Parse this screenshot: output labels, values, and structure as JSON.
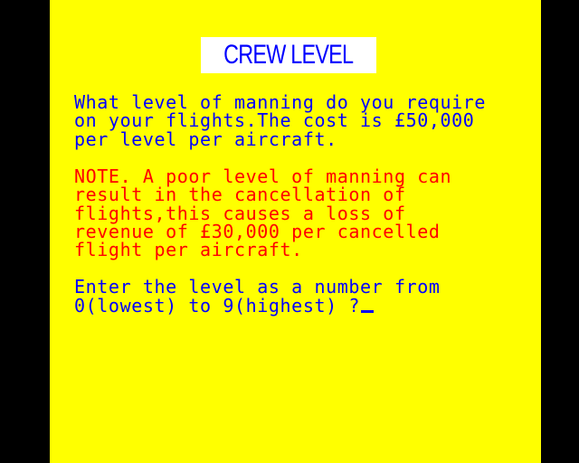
{
  "colors": {
    "background": "#ffff00",
    "border": "#000000",
    "title_box": "#ffffff",
    "title_text": "#0000ff",
    "question_text": "#0000ff",
    "note_text": "#ff0000",
    "prompt_text": "#0000ff"
  },
  "title": "CREW LEVEL",
  "question": {
    "lines": [
      "What level of manning do you require",
      "on your flights.The cost is £50,000",
      "per level per aircraft."
    ]
  },
  "note": {
    "lines": [
      "NOTE. A poor level of manning can",
      "result in the cancellation of",
      "flights,this causes a loss of",
      "revenue of £30,000 per cancelled",
      "flight per aircraft."
    ]
  },
  "prompt": {
    "lines": [
      "Enter the level as a number from",
      "0(lowest) to 9(highest) ?"
    ],
    "input_value": ""
  }
}
